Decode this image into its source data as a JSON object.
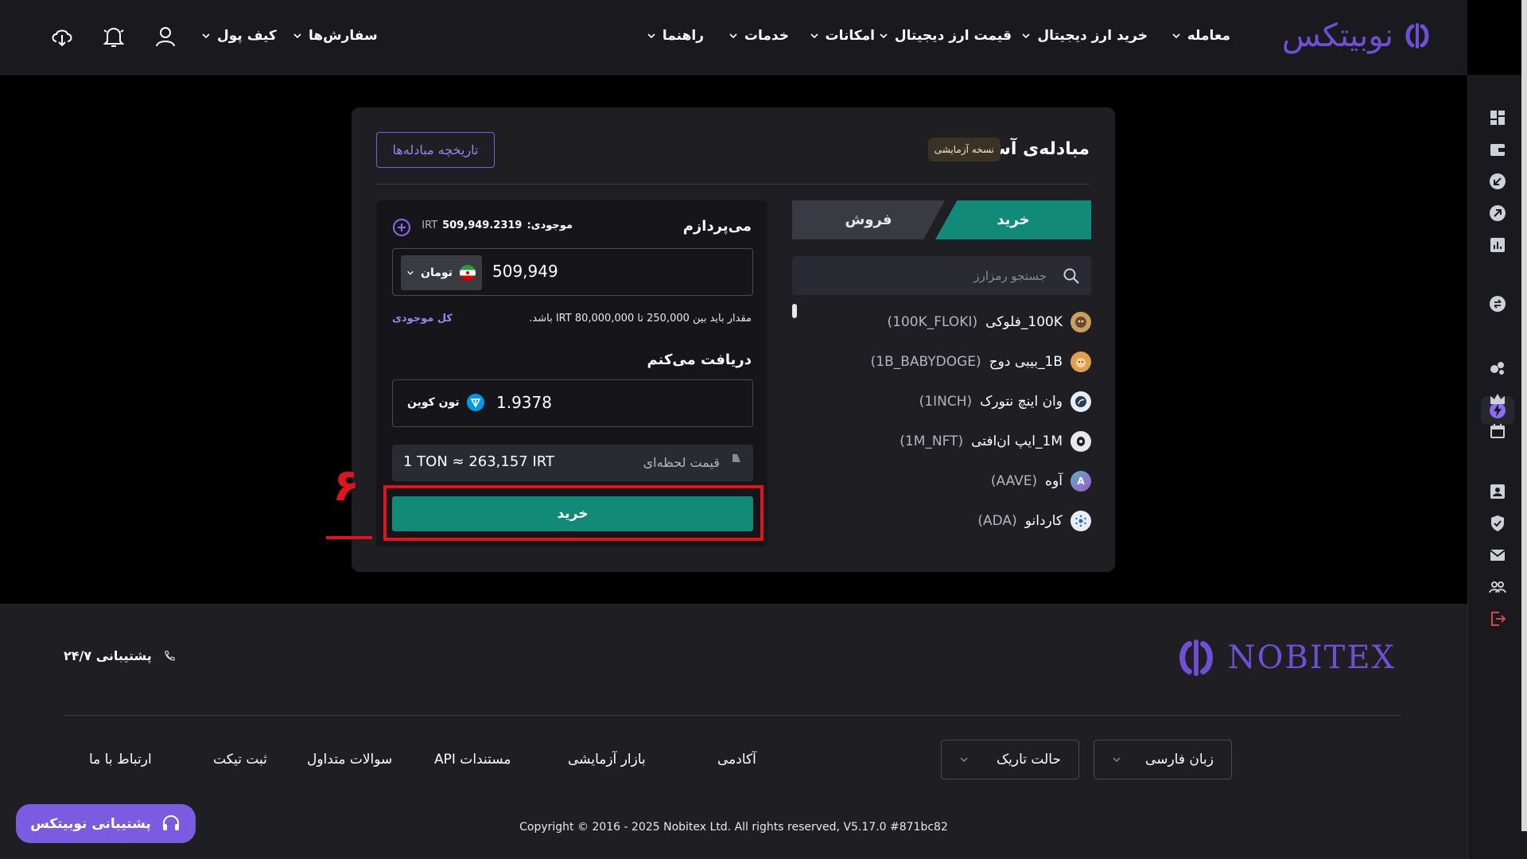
{
  "header": {
    "brand": "نوبیتکس",
    "nav": [
      "معامله",
      "خرید ارز دیجیتال",
      "قیمت ارز دیجیتال",
      "امکانات",
      "خدمات",
      "راهنما"
    ],
    "orders": "سفارش‌ها",
    "wallet": "کیف پول"
  },
  "exchange": {
    "title": "مبادله‌ی آسان",
    "beta_badge": "نسخه آزمایشی",
    "history_button": "تاریخچه مبادله‌ها",
    "tabs": {
      "buy": "خرید",
      "sell": "فروش"
    },
    "search_placeholder": "جستجو رمزارز",
    "coins": [
      {
        "name": "100K_فلوکی",
        "symbol": "(100K_FLOKI)",
        "icon": "floki-icon",
        "color": "#c9a060"
      },
      {
        "name": "1B_بیبی دوج",
        "symbol": "(1B_BABYDOGE)",
        "icon": "babydoge-icon",
        "color": "#e0a050"
      },
      {
        "name": "وان اینچ نتورک",
        "symbol": "(1INCH)",
        "icon": "1inch-icon",
        "color": "#2c3a5a"
      },
      {
        "name": "1M_ایپ ان‌افتی",
        "symbol": "(1M_NFT)",
        "icon": "ape-nft-icon",
        "color": "#e8e8ec"
      },
      {
        "name": "آوه",
        "symbol": "(AAVE)",
        "icon": "aave-icon",
        "color": "#7a6ad6"
      },
      {
        "name": "کاردانو",
        "symbol": "(ADA)",
        "icon": "cardano-icon",
        "color": "#e8eef8"
      }
    ],
    "pay": {
      "label": "می‌پردازم",
      "balance_label": "موجودی:",
      "balance_value": "509,949.2319",
      "balance_unit": "IRT",
      "amount": "509,949",
      "currency": "تومان",
      "hint": "مقدار باید بین 250,000 تا 80,000,000 IRT باشد.",
      "all_balance": "کل موجودی"
    },
    "receive": {
      "label": "دریافت می‌کنم",
      "amount": "1.9378",
      "currency": "تون کوین"
    },
    "rate": {
      "label": "قیمت لحظه‌ای",
      "value": "1 TON ≈ 263,157 IRT"
    },
    "submit": "خرید"
  },
  "annotation": {
    "step": "۶",
    "color": "#e0141e"
  },
  "footer": {
    "brand": "NOBITEX",
    "support": "پشتیبانی ۲۴/۷",
    "links": [
      "آکادمی",
      "بازار آزمایشی",
      "مستندات API",
      "سوالات متداول",
      "ثبت تیکت",
      "ارتباط با ما"
    ],
    "language": "زبان فارسی",
    "theme": "حالت تاریک",
    "copyright": "Copyright © 2016 - 2025 Nobitex Ltd. All rights reserved, V5.17.0 #871bc82",
    "support_button": "پشتیبانی نوبیتکس"
  },
  "colors": {
    "accent": "#7a5ce0",
    "buy": "#128a7a",
    "background": "#000000"
  }
}
